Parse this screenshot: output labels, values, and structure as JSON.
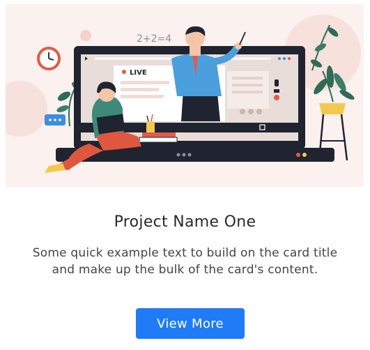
{
  "card": {
    "image_alt": "Online teaching illustration",
    "board_text": "2+2=4",
    "live_label": "LIVE",
    "title": "Project Name One",
    "text": "Some quick example text to build on the card title and make up the bulk of the card's content.",
    "button_label": "View More"
  },
  "colors": {
    "hero_bg": "#fbf1ee",
    "button_bg": "#1f7cf6",
    "laptop_frame": "#1f2430",
    "screen_bg": "#e9ddd9",
    "jacket": "#4a9fdc",
    "pants": "#e0573f",
    "plant": "#2f6b57"
  }
}
